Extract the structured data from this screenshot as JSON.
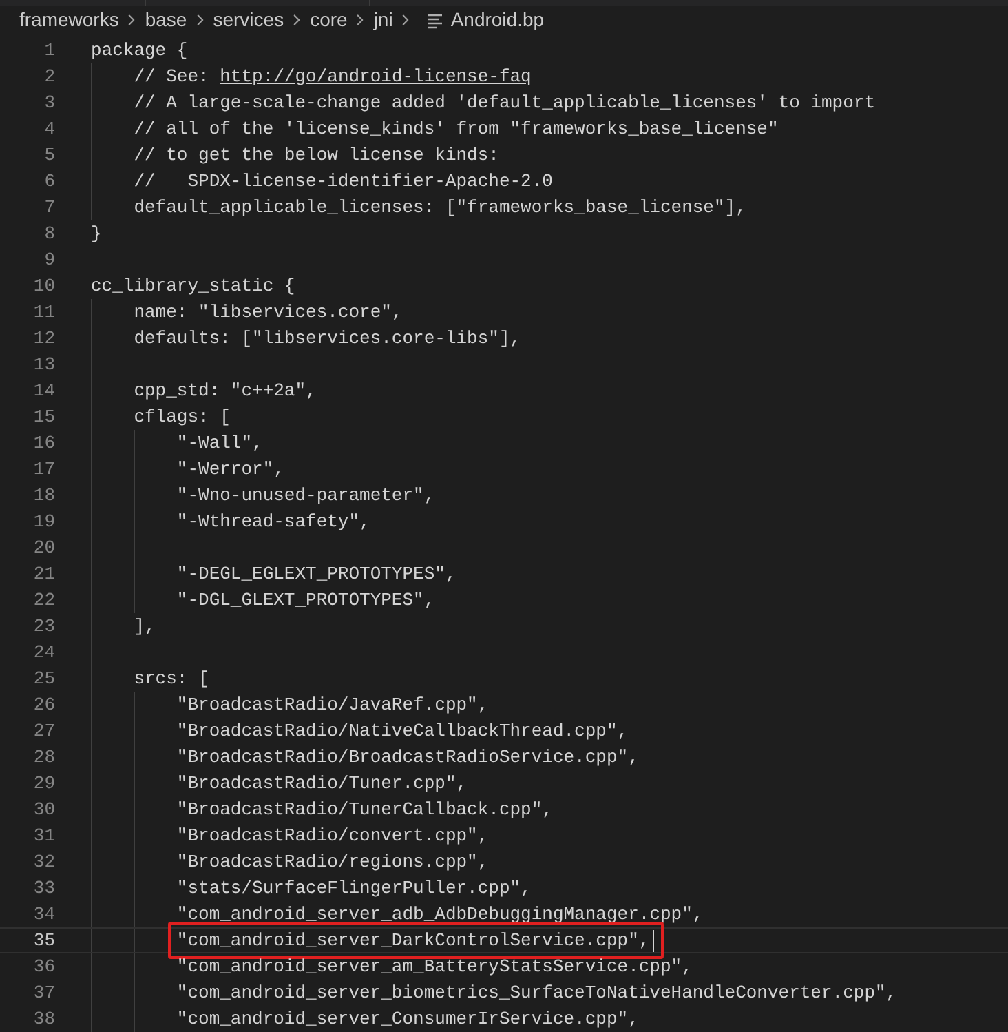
{
  "breadcrumb": [
    "frameworks",
    "base",
    "services",
    "core",
    "jni"
  ],
  "file": {
    "name": "Android.bp"
  },
  "lines": [
    {
      "number": "1",
      "text": "package {",
      "current": false,
      "marked": false
    },
    {
      "number": "2",
      "text": "    // See: ",
      "link": "http://go/android-license-faq",
      "current": false,
      "marked": false
    },
    {
      "number": "3",
      "text": "    // A large-scale-change added 'default_applicable_licenses' to import",
      "current": false,
      "marked": false
    },
    {
      "number": "4",
      "text": "    // all of the 'license_kinds' from \"frameworks_base_license\"",
      "current": false,
      "marked": false
    },
    {
      "number": "5",
      "text": "    // to get the below license kinds:",
      "current": false,
      "marked": false
    },
    {
      "number": "6",
      "text": "    //   SPDX-license-identifier-Apache-2.0",
      "current": false,
      "marked": false
    },
    {
      "number": "7",
      "text": "    default_applicable_licenses: [\"frameworks_base_license\"],",
      "current": false,
      "marked": false
    },
    {
      "number": "8",
      "text": "}",
      "current": false,
      "marked": false
    },
    {
      "number": "9",
      "current": false,
      "marked": false
    },
    {
      "number": "10",
      "text": "cc_library_static {",
      "current": false,
      "marked": false
    },
    {
      "number": "11",
      "text": "    name: \"libservices.core\",",
      "current": false,
      "marked": false
    },
    {
      "number": "12",
      "text": "    defaults: [\"libservices.core-libs\"],",
      "current": false,
      "marked": false
    },
    {
      "number": "13",
      "current": false,
      "marked": false
    },
    {
      "number": "14",
      "text": "    cpp_std: \"c++2a\",",
      "current": false,
      "marked": false
    },
    {
      "number": "15",
      "text": "    cflags: [",
      "current": false,
      "marked": false
    },
    {
      "number": "16",
      "text": "        \"-Wall\",",
      "current": false,
      "marked": false
    },
    {
      "number": "17",
      "text": "        \"-Werror\",",
      "current": false,
      "marked": false
    },
    {
      "number": "18",
      "text": "        \"-Wno-unused-parameter\",",
      "current": false,
      "marked": false
    },
    {
      "number": "19",
      "text": "        \"-Wthread-safety\",",
      "current": false,
      "marked": false
    },
    {
      "number": "20",
      "current": false,
      "marked": false
    },
    {
      "number": "21",
      "text": "        \"-DEGL_EGLEXT_PROTOTYPES\",",
      "current": false,
      "marked": false
    },
    {
      "number": "22",
      "text": "        \"-DGL_GLEXT_PROTOTYPES\",",
      "current": false,
      "marked": false
    },
    {
      "number": "23",
      "text": "    ],",
      "current": false,
      "marked": false
    },
    {
      "number": "24",
      "current": false,
      "marked": false
    },
    {
      "number": "25",
      "text": "    srcs: [",
      "current": false,
      "marked": false
    },
    {
      "number": "26",
      "text": "        \"BroadcastRadio/JavaRef.cpp\",",
      "current": false,
      "marked": false
    },
    {
      "number": "27",
      "text": "        \"BroadcastRadio/NativeCallbackThread.cpp\",",
      "current": false,
      "marked": false
    },
    {
      "number": "28",
      "text": "        \"BroadcastRadio/BroadcastRadioService.cpp\",",
      "current": false,
      "marked": false
    },
    {
      "number": "29",
      "text": "        \"BroadcastRadio/Tuner.cpp\",",
      "current": false,
      "marked": false
    },
    {
      "number": "30",
      "text": "        \"BroadcastRadio/TunerCallback.cpp\",",
      "current": false,
      "marked": false
    },
    {
      "number": "31",
      "text": "        \"BroadcastRadio/convert.cpp\",",
      "current": false,
      "marked": false
    },
    {
      "number": "32",
      "text": "        \"BroadcastRadio/regions.cpp\",",
      "current": false,
      "marked": false
    },
    {
      "number": "33",
      "text": "        \"stats/SurfaceFlingerPuller.cpp\",",
      "current": false,
      "marked": false
    },
    {
      "number": "34",
      "text": "        \"com_android_server_adb_AdbDebuggingManager.cpp\",",
      "current": false,
      "marked": false
    },
    {
      "number": "35",
      "text": "        \"com_android_server_DarkControlService.cpp\",",
      "current": true,
      "marked": true
    },
    {
      "number": "36",
      "text": "        \"com_android_server_am_BatteryStatsService.cpp\",",
      "current": false,
      "marked": false
    },
    {
      "number": "37",
      "text": "        \"com_android_server_biometrics_SurfaceToNativeHandleConverter.cpp\",",
      "current": false,
      "marked": false
    },
    {
      "number": "38",
      "text": "        \"com_android_server_ConsumerIrService.cpp\",",
      "current": false,
      "marked": false
    }
  ]
}
